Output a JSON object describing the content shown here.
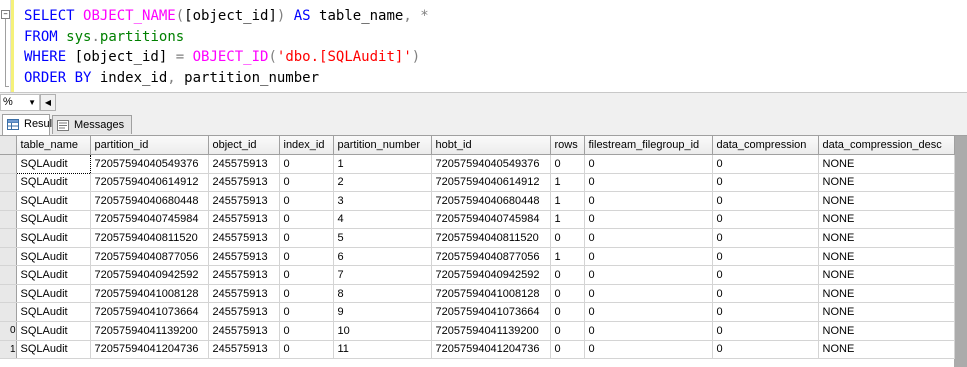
{
  "editor": {
    "collapse_glyph": "−",
    "line1": {
      "kw1": "SELECT ",
      "fn1": "OBJECT_NAME",
      "op1": "(",
      "t1": "[object_id]",
      "op2": ")",
      "kw2": " AS ",
      "t2": "table_name",
      "op3": ", ",
      "op4": "*"
    },
    "line2": {
      "kw1": "FROM ",
      "sys1": "sys",
      "op1": ".",
      "sys2": "partitions"
    },
    "line3": {
      "kw1": "WHERE ",
      "t1": "[object_id] ",
      "op1": "= ",
      "fn1": "OBJECT_ID",
      "op2": "(",
      "str1": "'dbo.[SQLAudit]'",
      "op3": ")"
    },
    "line4": {
      "kw1": "ORDER BY ",
      "t1": "index_id",
      "op1": ", ",
      "t2": "partition_number"
    }
  },
  "zoom": {
    "value": "%",
    "arrow": "▼",
    "scroll_left": "◀"
  },
  "tabs": [
    {
      "label": "Results",
      "active": true,
      "icon": "grid-icon"
    },
    {
      "label": "Messages",
      "active": false,
      "icon": "messages-icon"
    }
  ],
  "grid": {
    "columns": [
      "table_name",
      "partition_id",
      "object_id",
      "index_id",
      "partition_number",
      "hobt_id",
      "rows",
      "filestream_filegroup_id",
      "data_compression",
      "data_compression_desc"
    ],
    "row_headers": [
      "",
      "",
      "",
      "",
      "",
      "",
      "",
      "",
      "",
      "0",
      "1"
    ],
    "rows": [
      [
        "SQLAudit",
        "72057594040549376",
        "245575913",
        "0",
        "1",
        "72057594040549376",
        "0",
        "0",
        "0",
        "NONE"
      ],
      [
        "SQLAudit",
        "72057594040614912",
        "245575913",
        "0",
        "2",
        "72057594040614912",
        "1",
        "0",
        "0",
        "NONE"
      ],
      [
        "SQLAudit",
        "72057594040680448",
        "245575913",
        "0",
        "3",
        "72057594040680448",
        "1",
        "0",
        "0",
        "NONE"
      ],
      [
        "SQLAudit",
        "72057594040745984",
        "245575913",
        "0",
        "4",
        "72057594040745984",
        "1",
        "0",
        "0",
        "NONE"
      ],
      [
        "SQLAudit",
        "72057594040811520",
        "245575913",
        "0",
        "5",
        "72057594040811520",
        "0",
        "0",
        "0",
        "NONE"
      ],
      [
        "SQLAudit",
        "72057594040877056",
        "245575913",
        "0",
        "6",
        "72057594040877056",
        "1",
        "0",
        "0",
        "NONE"
      ],
      [
        "SQLAudit",
        "72057594040942592",
        "245575913",
        "0",
        "7",
        "72057594040942592",
        "0",
        "0",
        "0",
        "NONE"
      ],
      [
        "SQLAudit",
        "72057594041008128",
        "245575913",
        "0",
        "8",
        "72057594041008128",
        "0",
        "0",
        "0",
        "NONE"
      ],
      [
        "SQLAudit",
        "72057594041073664",
        "245575913",
        "0",
        "9",
        "72057594041073664",
        "0",
        "0",
        "0",
        "NONE"
      ],
      [
        "SQLAudit",
        "72057594041139200",
        "245575913",
        "0",
        "10",
        "72057594041139200",
        "0",
        "0",
        "0",
        "NONE"
      ],
      [
        "SQLAudit",
        "72057594041204736",
        "245575913",
        "0",
        "11",
        "72057594041204736",
        "0",
        "0",
        "0",
        "NONE"
      ]
    ]
  }
}
